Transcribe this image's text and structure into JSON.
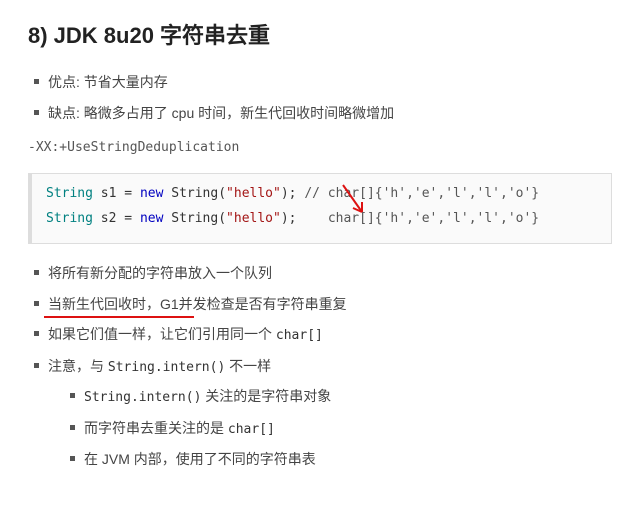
{
  "title": "8) JDK 8u20 字符串去重",
  "top_list": {
    "item1_label": "优点:",
    "item1_text": " 节省大量内存",
    "item2_label": "缺点:",
    "item2_text": " 略微多占用了 cpu 时间，新生代回收时间略微增加"
  },
  "flag": "-XX:+UseStringDeduplication",
  "code": {
    "l1": {
      "type": "String",
      "var": "s1",
      "eq": " = ",
      "kw": "new",
      "ctor": " String(",
      "str": "\"hello\"",
      "close": "); ",
      "comment": "// char[]{'h','e','l','l','o'}"
    },
    "l2": {
      "type": "String",
      "var": "s2",
      "eq": " = ",
      "kw": "new",
      "ctor": " String(",
      "str": "\"hello\"",
      "close": "); ",
      "tail": "char[]{'h','e','l','l','o'}"
    }
  },
  "body_list": {
    "i1": "将所有新分配的字符串放入一个队列",
    "i2": "当新生代回收时，G1并发检查是否有字符串重复",
    "i3_a": "如果它们值一样，让它们引用同一个 ",
    "i3_code": "char[]",
    "i4_a": "注意，与 ",
    "i4_code": "String.intern()",
    "i4_b": " 不一样",
    "sub": {
      "s1_code": "String.intern()",
      "s1_b": " 关注的是字符串对象",
      "s2_a": "而字符串去重关注的是 ",
      "s2_code": "char[]",
      "s3": "在 JVM 内部，使用了不同的字符串表"
    }
  }
}
